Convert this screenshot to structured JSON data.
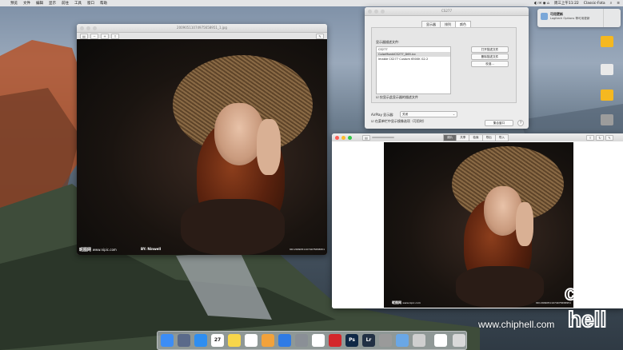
{
  "menubar": {
    "apple": "",
    "items": [
      "预览",
      "文件",
      "编辑",
      "显示",
      "前往",
      "工具",
      "窗口",
      "帮助"
    ],
    "right_status": "周三上午11:22",
    "right_user": "Classic-Fota"
  },
  "notification": {
    "title": "可用更新",
    "body": "Logitech Options 等可用更新"
  },
  "preview_small": {
    "title": "20090511074975658951_1.jpg",
    "watermark_logo": "昵图网",
    "watermark_url": "www.nipic.com",
    "watermark_by": "BY: Ninwell",
    "watermark_id": "NO:20090511074975658951"
  },
  "prefs": {
    "title": "CS277",
    "tabs": [
      "显示器",
      "排列",
      "颜色"
    ],
    "selected_tab": "颜色",
    "profile_label": "显示器描述文件:",
    "profiles": [
      "CS277",
      "ColorMonkiCS277_D65.icc",
      "Imable CS277 Custom 6500K G2.2"
    ],
    "selected_profile": "ColorMonkiCS277_D65.icc",
    "open_button": "打开描述文件",
    "delete_button": "删除描述文件",
    "calibrate_button": "校准...",
    "checkbox_label": "仅显示此显示器的描述文件",
    "airplay_label": "AirPlay 显示器:",
    "airplay_value": "关闭",
    "mirror_label": "在菜单栏中显示镜像选项（可用时）",
    "gather_button": "集合窗口",
    "help_button": "?"
  },
  "preview_large": {
    "segments": [
      "调片",
      "共享",
      "检索",
      "导出",
      "导入"
    ],
    "watermark_logo": "昵图网",
    "watermark_url": "www.nipic.com",
    "watermark_id": "NO:20090511074975658951"
  },
  "site_watermark": "www.chiphell.com",
  "chiphell_logo": "chip hell",
  "dock": {
    "icons": [
      {
        "name": "finder",
        "color": "#3d8df5",
        "label": ""
      },
      {
        "name": "launchpad",
        "color": "#5a6a8a",
        "label": ""
      },
      {
        "name": "safari",
        "color": "#2f8ef0",
        "label": ""
      },
      {
        "name": "calendar",
        "color": "#ffffff",
        "label": "27"
      },
      {
        "name": "notes",
        "color": "#f7d64a",
        "label": ""
      },
      {
        "name": "reminders",
        "color": "#ffffff",
        "label": ""
      },
      {
        "name": "photos",
        "color": "#f2a23b",
        "label": ""
      },
      {
        "name": "app-store",
        "color": "#2f7be5",
        "label": ""
      },
      {
        "name": "system-preferences",
        "color": "#8a8f96",
        "label": ""
      },
      {
        "name": "qq",
        "color": "#ffffff",
        "label": ""
      },
      {
        "name": "netease-music",
        "color": "#d3272b",
        "label": ""
      },
      {
        "name": "photoshop",
        "color": "#0f2846",
        "label": "Ps"
      },
      {
        "name": "lightroom",
        "color": "#223144",
        "label": "Lr"
      },
      {
        "name": "utility",
        "color": "#9a9a9a",
        "label": ""
      },
      {
        "name": "preview",
        "color": "#6aa7e6",
        "label": ""
      },
      {
        "name": "image-capture",
        "color": "#cfcfcf",
        "label": ""
      },
      {
        "name": "documents",
        "color": "#ffffff",
        "label": ""
      },
      {
        "name": "trash",
        "color": "#d9d9d9",
        "label": ""
      }
    ]
  },
  "desktop_icons": [
    {
      "name": "folder-1",
      "color": "#f5b820"
    },
    {
      "name": "drive-1",
      "color": "#e9e9e9"
    },
    {
      "name": "folder-2",
      "color": "#f5b820"
    },
    {
      "name": "drive-2",
      "color": "#9c9c9c"
    }
  ]
}
